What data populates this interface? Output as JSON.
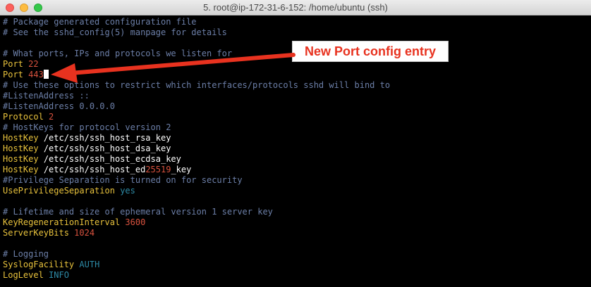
{
  "window": {
    "title": "5. root@ip-172-31-6-152: /home/ubuntu (ssh)"
  },
  "annotation": {
    "text": "New Port config entry",
    "color": "#e8321f"
  },
  "colors": {
    "comment": "#6c7fa8",
    "key": "#e8c23c",
    "number": "#d9523e",
    "keyword": "#2d8aa6",
    "text": "#ffffff"
  },
  "lines": [
    {
      "comment": "# Package generated configuration file"
    },
    {
      "comment": "# See the sshd_config(5) manpage for details"
    },
    {},
    {
      "comment": "# What ports, IPs and protocols we listen for"
    },
    {
      "key": "Port",
      "number": "22"
    },
    {
      "key": "Port",
      "number": "443",
      "cursor": true
    },
    {
      "comment": "# Use these options to restrict which interfaces/protocols sshd will bind to"
    },
    {
      "comment": "#ListenAddress ::"
    },
    {
      "comment": "#ListenAddress 0.0.0.0"
    },
    {
      "key": "Protocol",
      "number": "2"
    },
    {
      "comment": "# HostKeys for protocol version 2"
    },
    {
      "key": "HostKey",
      "text": "/etc/ssh/ssh_host_rsa_key"
    },
    {
      "key": "HostKey",
      "text": "/etc/ssh/ssh_host_dsa_key"
    },
    {
      "key": "HostKey",
      "text": "/etc/ssh/ssh_host_ecdsa_key"
    },
    {
      "key": "HostKey",
      "text": "/etc/ssh/ssh_host_ed",
      "number_inline": "25519",
      "text_after": "_key"
    },
    {
      "comment": "#Privilege Separation is turned on for security"
    },
    {
      "key": "UsePrivilegeSeparation",
      "keyword": "yes"
    },
    {},
    {
      "comment": "# Lifetime and size of ephemeral version 1 server key"
    },
    {
      "key": "KeyRegenerationInterval",
      "number": "3600"
    },
    {
      "key": "ServerKeyBits",
      "number": "1024"
    },
    {},
    {
      "comment": "# Logging"
    },
    {
      "key": "SyslogFacility",
      "keyword": "AUTH"
    },
    {
      "key": "LogLevel",
      "keyword": "INFO"
    }
  ]
}
